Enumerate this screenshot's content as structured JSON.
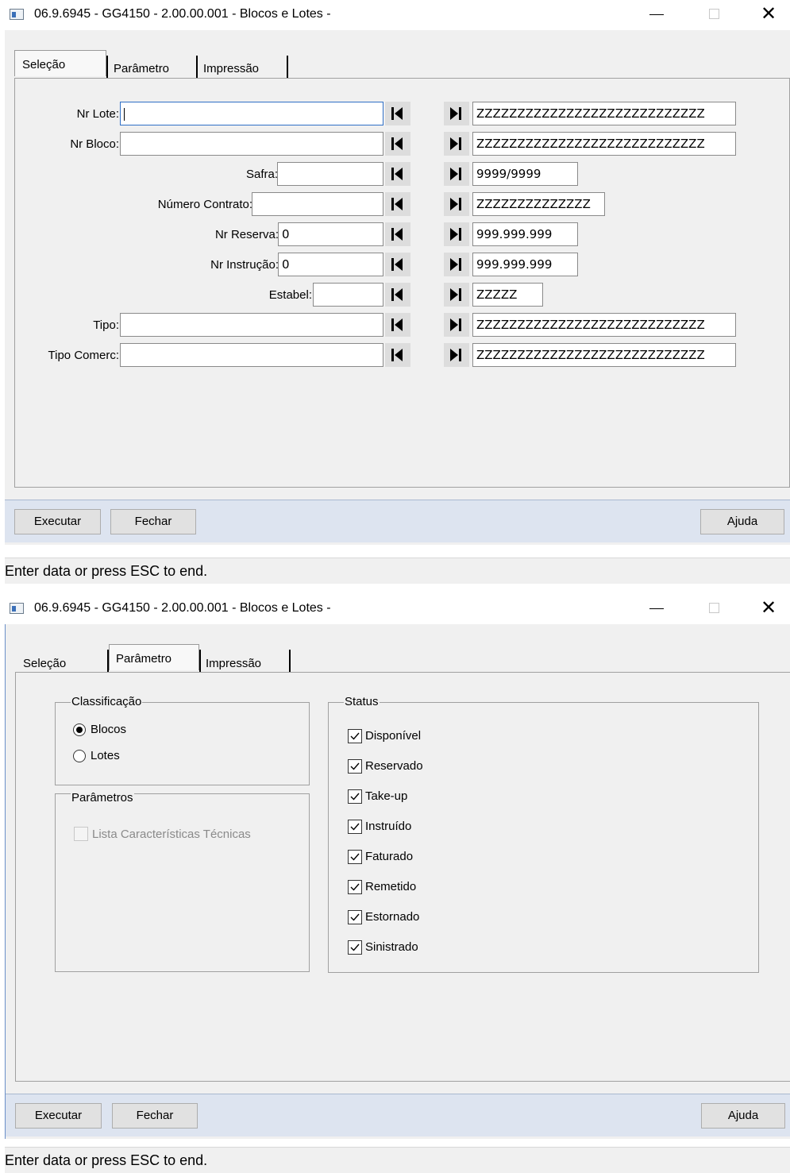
{
  "window": {
    "title": "06.9.6945 - GG4150 - 2.00.00.001 - Blocos e Lotes -",
    "minimize_symbol": "—",
    "close_symbol": "✕"
  },
  "tabs": [
    "Seleção",
    "Parâmetro",
    "Impressão"
  ],
  "selecao": {
    "rows": [
      {
        "label": "Nr Lote:",
        "from": "",
        "to": "ZZZZZZZZZZZZZZZZZZZZZZZZZZZZ"
      },
      {
        "label": "Nr Bloco:",
        "from": "",
        "to": "ZZZZZZZZZZZZZZZZZZZZZZZZZZZZ"
      },
      {
        "label": "Safra:",
        "from": "",
        "to": "9999/9999"
      },
      {
        "label": "Número Contrato:",
        "from": "",
        "to": "ZZZZZZZZZZZZZZ"
      },
      {
        "label": "Nr Reserva:",
        "from": "0",
        "to": "999.999.999"
      },
      {
        "label": "Nr Instrução:",
        "from": "0",
        "to": "999.999.999"
      },
      {
        "label": "Estabel:",
        "from": "",
        "to": "ZZZZZ"
      },
      {
        "label": "Tipo:",
        "from": "",
        "to": "ZZZZZZZZZZZZZZZZZZZZZZZZZZZZ"
      },
      {
        "label": "Tipo Comerc:",
        "from": "",
        "to": "ZZZZZZZZZZZZZZZZZZZZZZZZZZZZ"
      }
    ],
    "first_icon": "skip-to-first-icon",
    "last_icon": "skip-to-last-icon"
  },
  "parametro": {
    "classificacao": {
      "title": "Classificação",
      "options": [
        "Blocos",
        "Lotes"
      ],
      "selected": "Blocos"
    },
    "parametros": {
      "title": "Parâmetros",
      "option": "Lista Características Técnicas",
      "checked": false,
      "enabled": false
    },
    "status": {
      "title": "Status",
      "items": [
        {
          "label": "Disponível",
          "checked": true
        },
        {
          "label": "Reservado",
          "checked": true
        },
        {
          "label": "Take-up",
          "checked": true
        },
        {
          "label": "Instruído",
          "checked": true
        },
        {
          "label": "Faturado",
          "checked": true
        },
        {
          "label": "Remetido",
          "checked": true
        },
        {
          "label": "Estornado",
          "checked": true
        },
        {
          "label": "Sinistrado",
          "checked": true
        }
      ]
    }
  },
  "buttons": {
    "executar": "Executar",
    "fechar": "Fechar",
    "ajuda": "Ajuda"
  },
  "status_bar": "Enter data or press ESC to end."
}
